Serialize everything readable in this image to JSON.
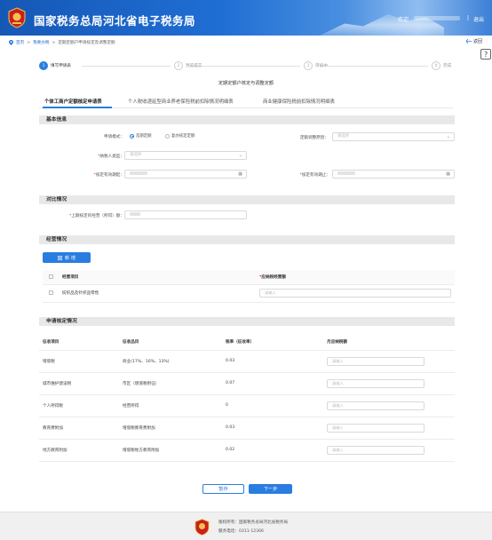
{
  "header": {
    "title": "国家税务总局河北省电子税务局",
    "welcome": "欢迎",
    "separator": "|",
    "logout": "退出"
  },
  "breadcrumb": {
    "home": "首页",
    "level1": "我要办税",
    "level2": "定期定额户申请核定及调整定额"
  },
  "back_label": "返回",
  "steps": [
    {
      "num": "1",
      "label": "填写申请表"
    },
    {
      "num": "2",
      "label": "预览提交"
    },
    {
      "num": "3",
      "label": "审核中"
    },
    {
      "num": "4",
      "label": "完成"
    }
  ],
  "page_heading": "定期定额户核定与调整定额",
  "tabs": [
    "个体工商户定额核定申请表",
    "个人税收递延型商业养老保险税前扣除情况明细表",
    "商业健康保险税前扣除情况明细表"
  ],
  "basic": {
    "section_title": "基本信息",
    "apply_type_label": "申请模式：",
    "apply_options": [
      "首期定额",
      "复办核定定额"
    ],
    "adjust_reason_label": "定额调整原因：",
    "adjust_reason_placeholder": "请选择",
    "taxpayer_type_label": "纳税人类型：",
    "taxpayer_type_placeholder": "请选择",
    "valid_from_label": "核定有效期起：",
    "valid_to_label": "核定有效期止：",
    "calendar_icon": "▦"
  },
  "compare": {
    "section_title": "对比情况",
    "last_income_label": "上期核定的经营（所得）额："
  },
  "operation": {
    "section_title": "经营情况",
    "add_button": "新 增",
    "col_item": "经营项目",
    "col_income": "应纳税经营额",
    "rows": [
      {
        "item": "纺织品及针织品零售",
        "placeholder": "请输入"
      }
    ]
  },
  "verify": {
    "section_title": "申请核定情况",
    "headers": [
      "征收项目",
      "征收品目",
      "税率（征收率）",
      "月应纳税额"
    ],
    "rows": [
      {
        "project": "增值税",
        "item": "商业(17%、16%、13%)",
        "rate": "0.03",
        "placeholder": "请输入"
      },
      {
        "project": "城市维护建设税",
        "item": "市区（增值税附征）",
        "rate": "0.07",
        "placeholder": "请输入"
      },
      {
        "project": "个人所得税",
        "item": "经营所得",
        "rate": "0",
        "placeholder": "请输入"
      },
      {
        "project": "教育费附加",
        "item": "增值税教育费附加",
        "rate": "0.03",
        "placeholder": "请输入"
      },
      {
        "project": "地方教育附加",
        "item": "增值税地方教育附加",
        "rate": "0.02",
        "placeholder": "请输入"
      }
    ]
  },
  "actions": {
    "save": "暂存",
    "next": "下一步"
  },
  "footer": {
    "line1": "版权所有：国家税务总局河北省税务局",
    "line2": "服务电话：0311-12366"
  },
  "colors": {
    "primary": "#2a7de0",
    "header": "#1658b6"
  }
}
